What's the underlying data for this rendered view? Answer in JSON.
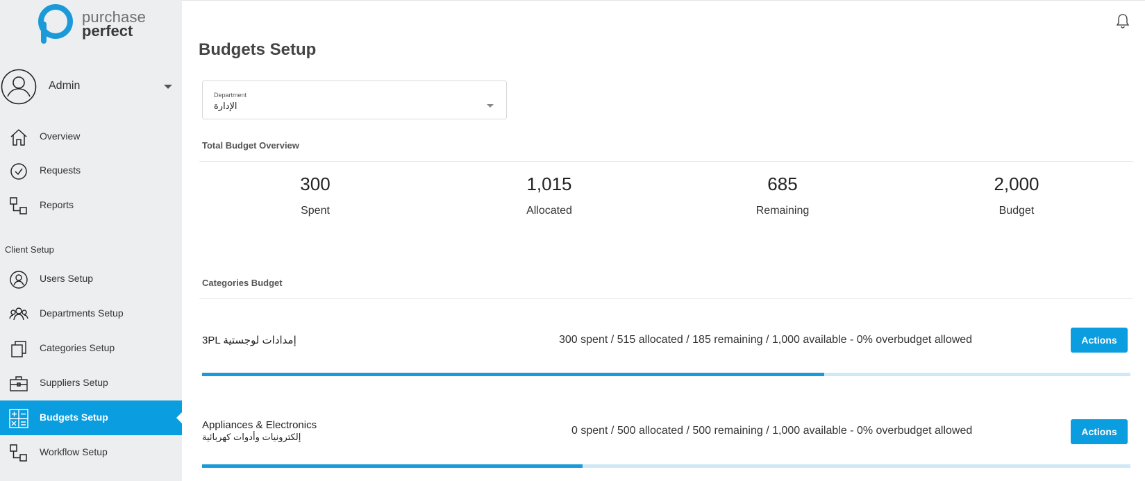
{
  "brand": {
    "line1": "purchase",
    "line2": "perfect"
  },
  "user": {
    "name": "Admin"
  },
  "nav": {
    "overview": "Overview",
    "requests": "Requests",
    "reports": "Reports",
    "section_client_setup": "Client Setup",
    "users_setup": "Users Setup",
    "departments_setup": "Departments Setup",
    "categories_setup": "Categories Setup",
    "suppliers_setup": "Suppliers Setup",
    "budgets_setup": "Budgets Setup",
    "workflow_setup": "Workflow Setup",
    "active": "budgets_setup"
  },
  "page": {
    "title": "Budgets Setup"
  },
  "department": {
    "label": "Department",
    "value": "الإدارة"
  },
  "overview": {
    "heading": "Total Budget Overview",
    "stats": [
      {
        "value": "300",
        "caption": "Spent"
      },
      {
        "value": "1,015",
        "caption": "Allocated"
      },
      {
        "value": "685",
        "caption": "Remaining"
      },
      {
        "value": "2,000",
        "caption": "Budget"
      }
    ]
  },
  "categories": {
    "heading": "Categories Budget",
    "items": [
      {
        "name": "3PL إمدادات لوجستية",
        "name_ar": "",
        "summary": "300 spent / 515 allocated / 185 remaining / 1,000 available - 0% overbudget allowed",
        "action_label": "Actions",
        "progress_percent": 67
      },
      {
        "name": "Appliances & Electronics",
        "name_ar": "إلكترونيات وأدوات كهربائية",
        "summary": "0 spent / 500 allocated / 500 remaining / 1,000 available - 0% overbudget allowed",
        "action_label": "Actions",
        "progress_percent": 41
      }
    ]
  },
  "colors": {
    "accent": "#0a9de0",
    "sidebar_bg": "#eceeef",
    "progress_track": "#cfe9f7"
  },
  "icons": {
    "logo": "purchase-perfect-logo",
    "bell": "bell-icon",
    "overview": "home-icon",
    "requests": "check-circle-icon",
    "reports": "flow-icon",
    "users_setup": "user-icon",
    "departments_setup": "users-group-icon",
    "categories_setup": "copy-icon",
    "suppliers_setup": "briefcase-icon",
    "budgets_setup": "calculator-icon",
    "workflow_setup": "flow-icon"
  }
}
